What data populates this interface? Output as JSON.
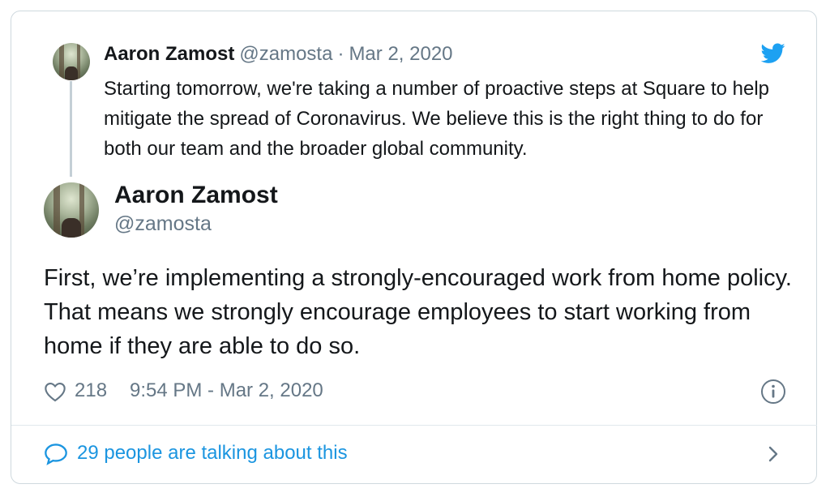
{
  "quoted_tweet": {
    "author_name": "Aaron Zamost",
    "author_handle": "@zamosta",
    "separator": "·",
    "date": "Mar 2, 2020",
    "text": "Starting tomorrow, we're taking a number of proactive steps at Square to help mitigate the spread of Coronavirus. We believe this is the right thing to do for both our team and the broader global community."
  },
  "main_tweet": {
    "author_name": "Aaron Zamost",
    "author_handle": "@zamosta",
    "text": "First, we’re implementing a strongly-encouraged work from home policy. That means we strongly encourage employees to start working from home if they are able to do so.",
    "like_count": "218",
    "timestamp": "9:54 PM - Mar 2, 2020"
  },
  "footer": {
    "talking_text": "29 people are talking about this"
  },
  "icons": {
    "brand": "twitter-bird-icon",
    "like": "heart-icon",
    "info": "info-icon",
    "reply": "speech-bubble-icon",
    "more": "chevron-right-icon"
  },
  "colors": {
    "twitter_blue": "#1da1f2",
    "link_blue": "#1b95e0",
    "muted_text": "#657786",
    "primary_text": "#14171a",
    "border": "#cfd9de"
  }
}
